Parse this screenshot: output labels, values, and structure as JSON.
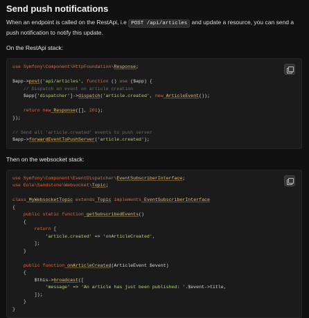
{
  "section": {
    "heading": "Send push notifications",
    "intro_before": "When an endpoint is called on the RestApi, i.e ",
    "intro_code": "POST /api/articles",
    "intro_after": " and update a resource, you can send a push notification to notify this update.",
    "restapi_label": "On the RestApi stack:",
    "websocket_label": "Then on the websocket stack:"
  },
  "icons": {
    "copy": "copy-icon"
  },
  "code1": {
    "l1_kw": "use ",
    "l1_ns": "Symfony\\Component\\HttpFoundation\\",
    "l1_cls": "Response",
    "l1_end": ";",
    "l3_a": "$app",
    "l3_b": "->",
    "l3_fn": "post",
    "l3_c": "(",
    "l3_str": "'api/articles'",
    "l3_d": ", ",
    "l3_kw": "function",
    "l3_e": " () ",
    "l3_kw2": "use",
    "l3_f": " ($app) {",
    "l4_cm": "    // Dispatch an event on article creation",
    "l5_a": "    $app[",
    "l5_str": "'dispatcher'",
    "l5_b": "]->",
    "l5_fn": "dispatch",
    "l5_c": "(",
    "l5_str2": "'article.created'",
    "l5_d": ", ",
    "l5_kw": "new",
    "l5_cls": " ArticleEvent",
    "l5_e": "());",
    "l7_a": "    ",
    "l7_kw": "return",
    "l7_b": " ",
    "l7_kw2": "new",
    "l7_cls": " Response",
    "l7_c": "([], ",
    "l7_num": "201",
    "l7_d": ");",
    "l8": "});",
    "l10_cm": "// Send all 'article.created' events to push server",
    "l11_a": "$app->",
    "l11_fn": "forwardEventToPushServer",
    "l11_b": "(",
    "l11_str": "'article.created'",
    "l11_c": ");"
  },
  "code2": {
    "l1_kw": "use ",
    "l1_ns": "Symfony\\Component\\EventDispatcher\\",
    "l1_cls": "EventSubscriberInterface",
    "l1_end": ";",
    "l2_kw": "use ",
    "l2_ns": "Eole\\Sandstone\\Websocket\\",
    "l2_cls": "Topic",
    "l2_end": ";",
    "l4_kw": "class",
    "l4_cls": " MyWebsocketTopic",
    "l4_kw2": " extends",
    "l4_cls2": " Topic",
    "l4_kw3": " implements",
    "l4_cls3": " EventSubscriberInterface",
    "l5": "{",
    "l6_a": "    ",
    "l6_kw": "public static function",
    "l6_fn": " getSubscribedEvents",
    "l6_b": "()",
    "l7": "    {",
    "l8_a": "        ",
    "l8_kw": "return",
    "l8_b": " [",
    "l9_a": "            ",
    "l9_str": "'article.created'",
    "l9_b": " => ",
    "l9_str2": "'onArticleCreated'",
    "l9_c": ",",
    "l10": "        ];",
    "l11": "    }",
    "l13_a": "    ",
    "l13_kw": "public function",
    "l13_fn": " onArticleCreated",
    "l13_b": "(ArticleEvent $event)",
    "l14": "    {",
    "l15_a": "        $this->",
    "l15_fn": "broadcast",
    "l15_b": "([",
    "l16_a": "            ",
    "l16_str": "'message'",
    "l16_b": " => ",
    "l16_str2": "'An article has just been published: '",
    "l16_c": ".$event->title,",
    "l17": "        ]);",
    "l18": "    }",
    "l19": "}"
  }
}
